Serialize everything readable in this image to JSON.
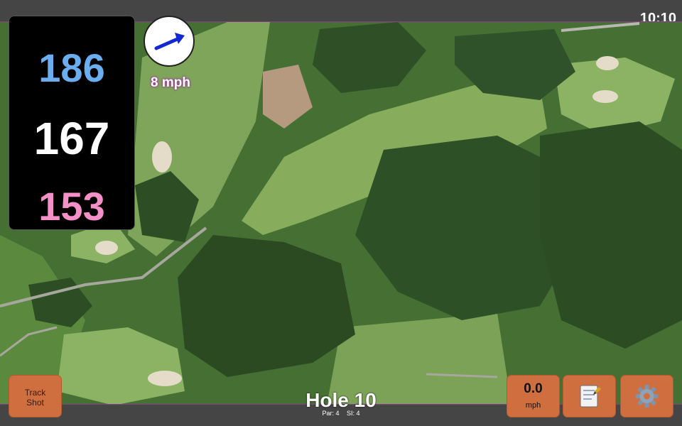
{
  "status": {
    "time": "10:10"
  },
  "distances": {
    "back": "186",
    "center": "167",
    "front": "153"
  },
  "wind": {
    "speed": "8 mph",
    "direction_icon": "arrow-right-icon"
  },
  "hole": {
    "title": "Hole 10",
    "par": "Par: 4",
    "si": "SI: 4"
  },
  "buttons": {
    "track_shot_line1": "Track",
    "track_shot_line2": "Shot",
    "speed_value": "0.0",
    "speed_unit": "mph",
    "notes_icon": "notepad-icon",
    "settings_icon": "gear-icon"
  },
  "colors": {
    "back_distance": "#6aaef0",
    "center_distance": "#ffffff",
    "front_distance": "#f58fc8",
    "button": "#cf6f3f"
  }
}
